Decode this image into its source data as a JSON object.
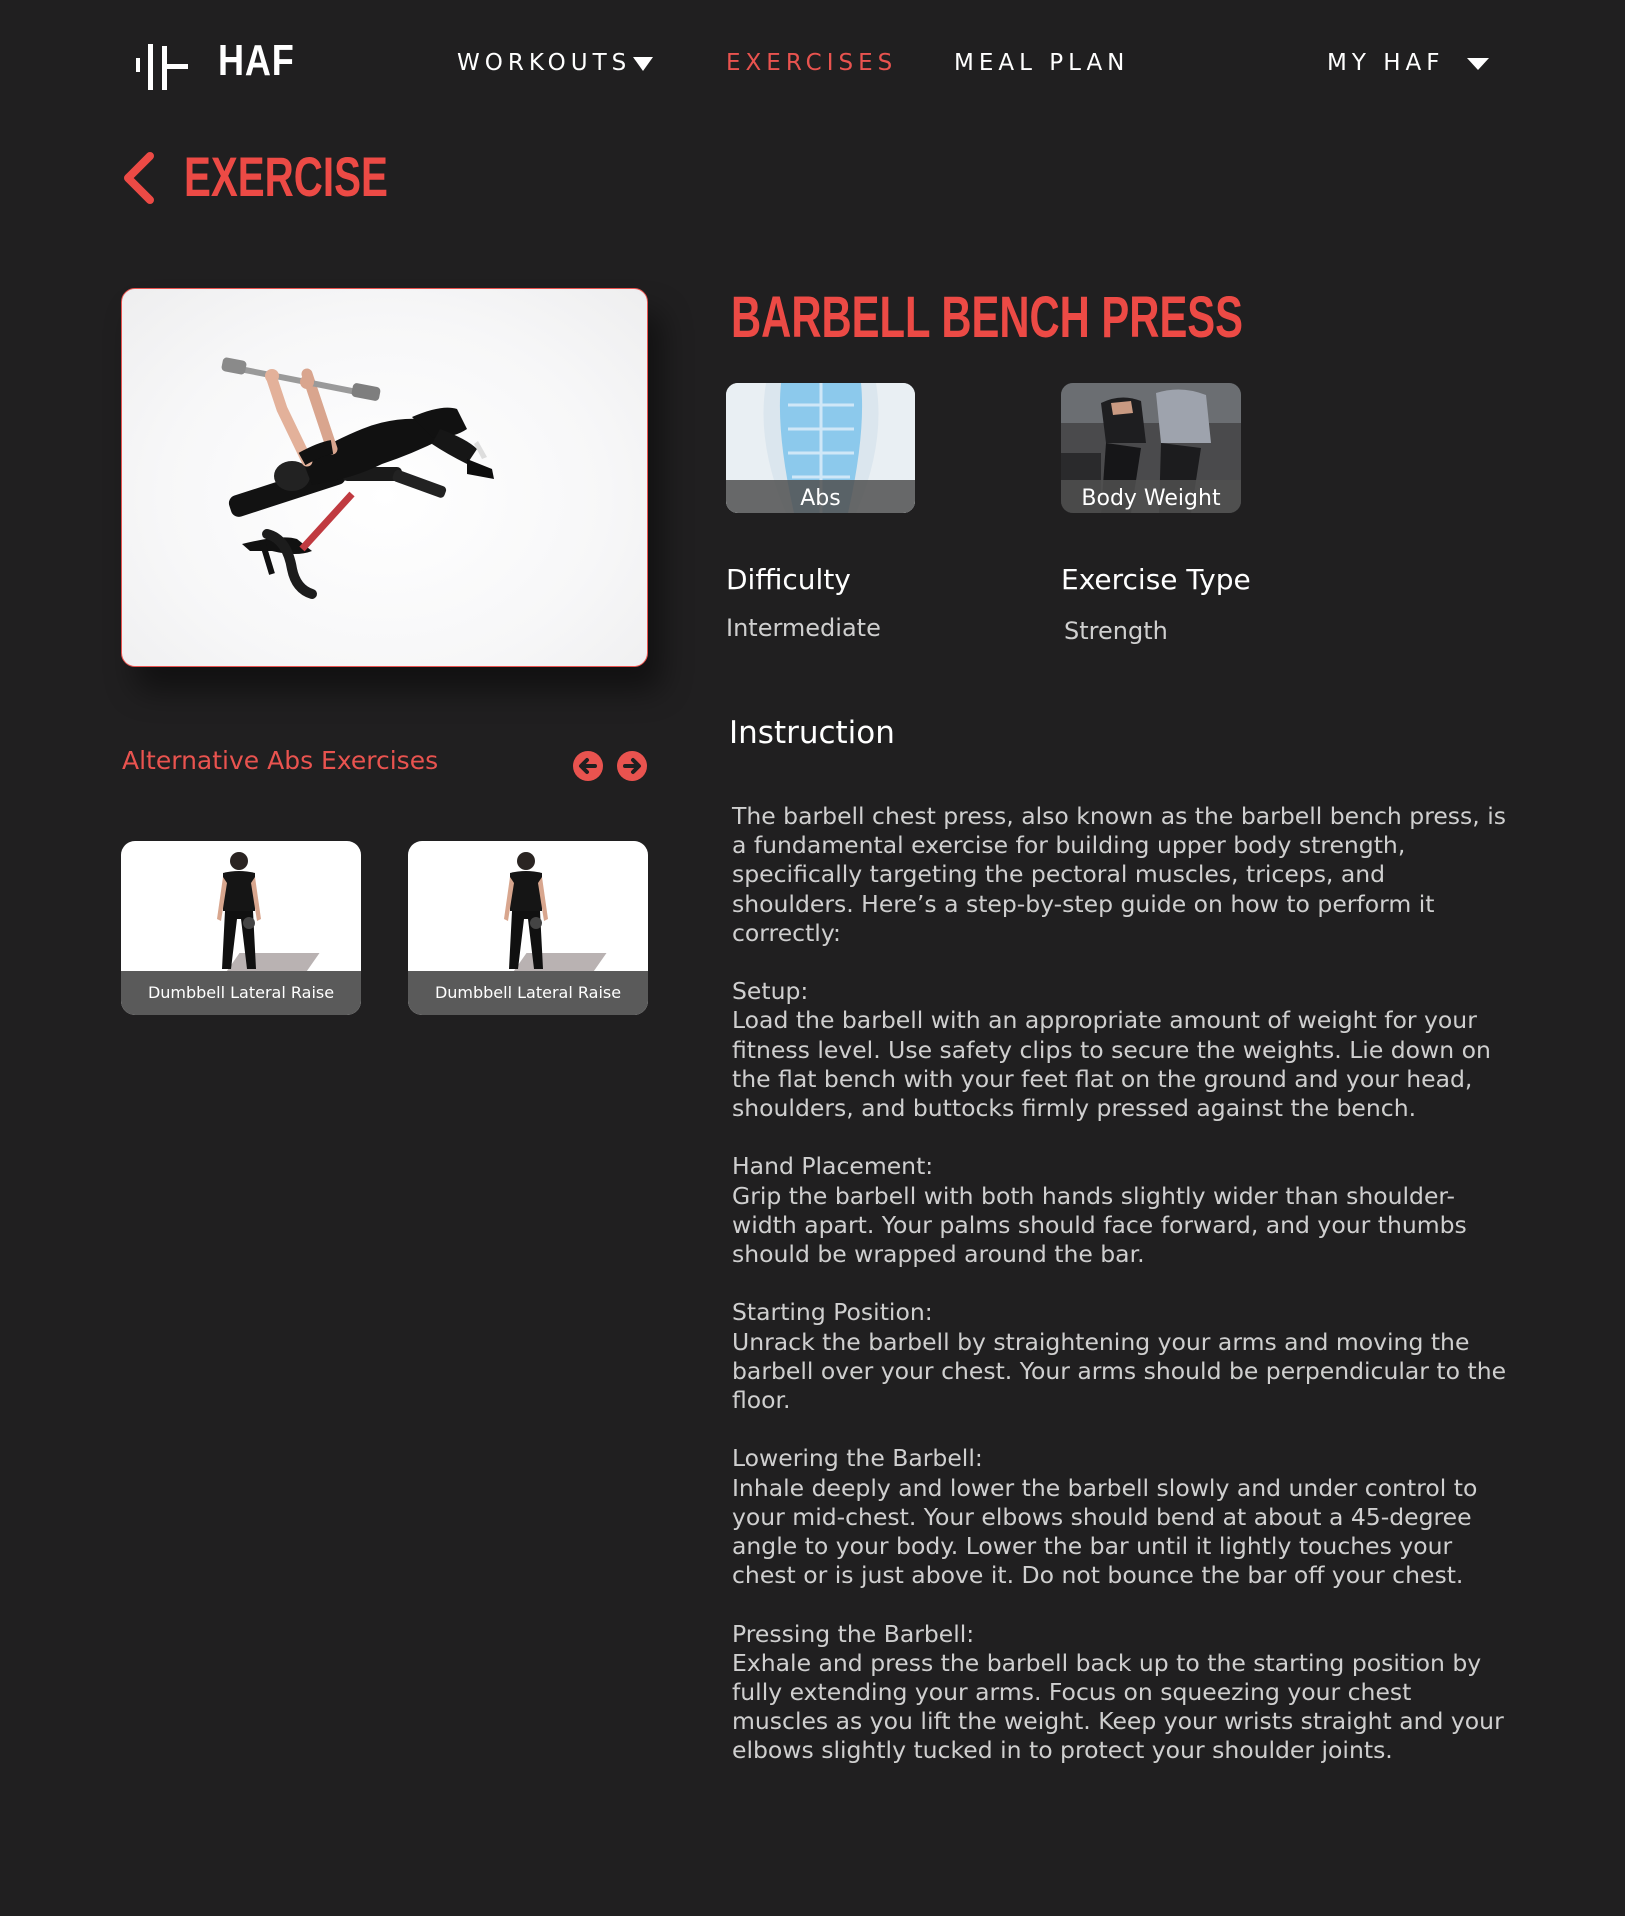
{
  "header": {
    "logo_text": "HAF",
    "nav": [
      {
        "label": "WORKOUTS",
        "active": false,
        "dropdown": true
      },
      {
        "label": "EXERCISES",
        "active": true,
        "dropdown": false
      },
      {
        "label": "MEAL PLAN",
        "active": false,
        "dropdown": false
      }
    ],
    "account_label": "MY HAF"
  },
  "page": {
    "title": "EXERCISE",
    "back_icon": "chevron-left-icon"
  },
  "exercise": {
    "name": "BARBELL BENCH PRESS",
    "muscle_tag": "Abs",
    "equipment_tag": "Body Weight",
    "difficulty_label": "Difficulty",
    "difficulty_value": "Intermediate",
    "type_label": "Exercise Type",
    "type_value": "Strength"
  },
  "alternatives": {
    "title": "Alternative Abs Exercises",
    "prev_icon": "arrow-left-icon",
    "next_icon": "arrow-right-icon",
    "items": [
      {
        "label": "Dumbbell Lateral Raise"
      },
      {
        "label": "Dumbbell Lateral Raise"
      }
    ]
  },
  "instruction": {
    "title": "Instruction",
    "paragraphs": [
      {
        "heading": "",
        "text": "The barbell chest press, also known as the barbell bench press, is a fundamental exercise for building upper body strength, specifically targeting the pectoral muscles, triceps, and shoulders. Here’s a step-by-step guide on how to perform it correctly:"
      },
      {
        "heading": "Setup:",
        "text": "Load the barbell with an appropriate amount of weight for your fitness level. Use safety clips to secure the weights. Lie down on the flat bench with your feet flat on the ground and your head, shoulders, and buttocks firmly pressed against the bench."
      },
      {
        "heading": "Hand Placement:",
        "text": "Grip the barbell with both hands slightly wider than shoulder-width apart. Your palms should face forward, and your thumbs should be wrapped around the bar."
      },
      {
        "heading": "Starting Position:",
        "text": "Unrack the barbell by straightening your arms and moving the barbell over your chest. Your arms should be perpendicular to the floor."
      },
      {
        "heading": "Lowering the Barbell:",
        "text": "Inhale deeply and lower the barbell slowly and under control to your mid-chest. Your elbows should bend at about a 45-degree angle to your body. Lower the bar until it lightly touches your chest or is just above it. Do not bounce the bar off your chest."
      },
      {
        "heading": "Pressing the Barbell:",
        "text": "Exhale and press the barbell back up to the starting position by fully extending your arms. Focus on squeezing your chest muscles as you lift the weight. Keep your wrists straight and your elbows slightly tucked in to protect your shoulder joints."
      }
    ]
  },
  "colors": {
    "background": "#201f20",
    "accent": "#e9534f",
    "text": "#cfcfcf"
  }
}
